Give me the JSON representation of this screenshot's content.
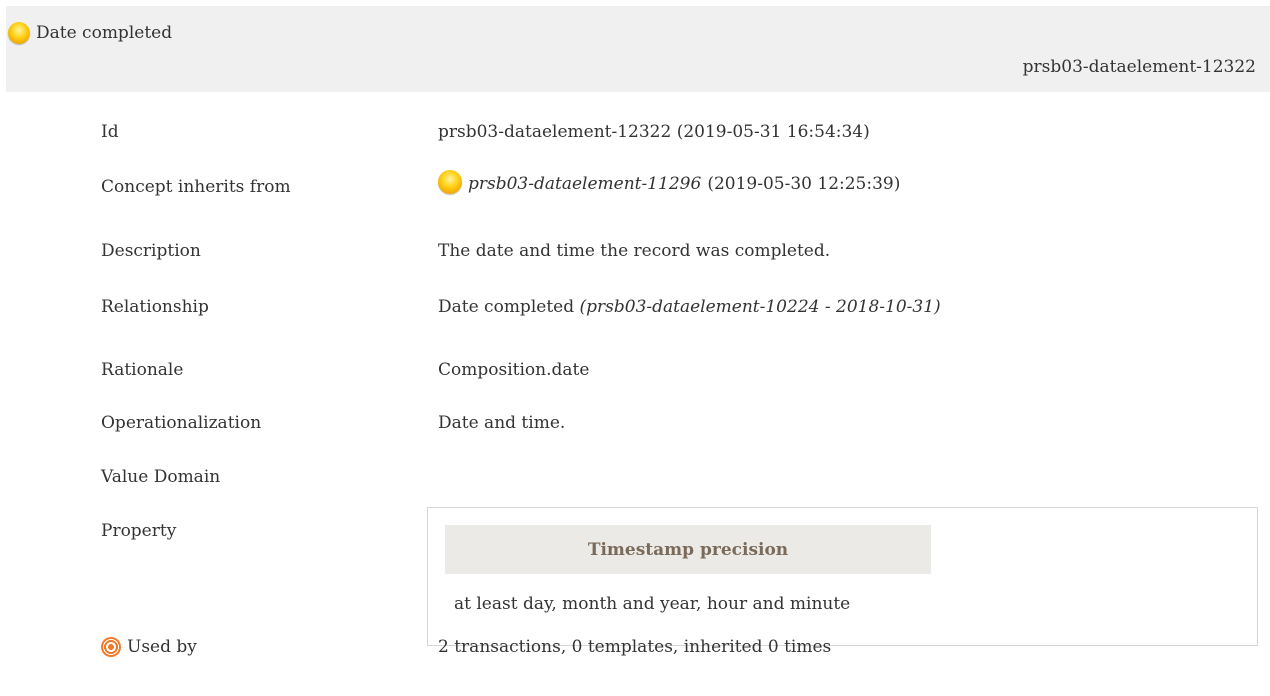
{
  "header": {
    "title": "Date completed",
    "id": "prsb03-dataelement-12322"
  },
  "fields": {
    "id": {
      "label": "Id",
      "value": "prsb03-dataelement-12322 (2019-05-31 16:54:34)"
    },
    "inherits": {
      "label": "Concept inherits from",
      "ref": "prsb03-dataelement-11296",
      "date": "(2019-05-30 12:25:39)"
    },
    "description": {
      "label": "Description",
      "value": "The date and time the record was completed."
    },
    "relationship": {
      "label": "Relationship",
      "name": "Date completed",
      "ref": "(prsb03-dataelement-10224 - 2018-10-31)"
    },
    "rationale": {
      "label": "Rationale",
      "value": "Composition.date"
    },
    "operationalization": {
      "label": "Operationalization",
      "value": "Date and time."
    },
    "value_domain": {
      "label": "Value Domain"
    },
    "property": {
      "label": "Property",
      "heading": "Timestamp precision",
      "value": "at least day, month and year, hour and minute"
    },
    "used_by": {
      "label": "Used by",
      "value": "2 transactions, 0 templates, inherited 0 times"
    }
  },
  "colors": {
    "header_bg": "#f0f0f0",
    "status_ball": "#ffd21a",
    "property_heading_bg": "#eceae6",
    "property_heading_text": "#7a6a5a",
    "used_by_icon": "#f07a2a"
  },
  "icons": {
    "status": "status-ball-icon",
    "used_by": "target-icon"
  }
}
